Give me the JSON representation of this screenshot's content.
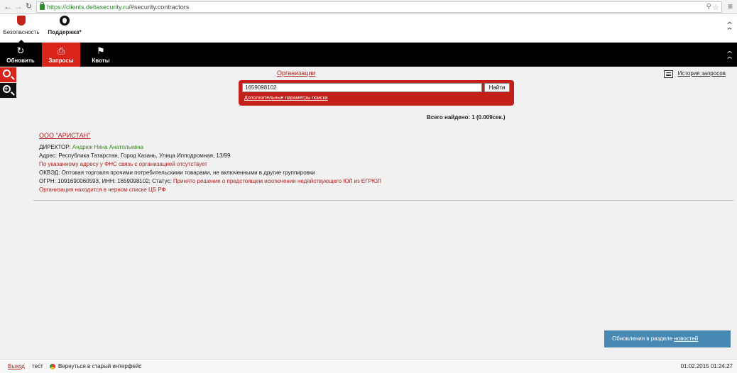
{
  "browser": {
    "url_host": "https://clients.deltasecurity.ru",
    "url_path": "/#security.contractors"
  },
  "topbar": {
    "security_label": "Безопасность",
    "support_label": "Поддержка*"
  },
  "toolbar": {
    "refresh_label": "Обновить",
    "requests_label": "Запросы",
    "quotas_label": "Квоты"
  },
  "search": {
    "category_link": "Организации",
    "query_value": "1659098102",
    "find_button": "Найти",
    "advanced_link": "Дополнительные параметры поиска",
    "history_link": "История запросов",
    "found_text": "Всего найдено: 1 (0.009сек.)"
  },
  "result": {
    "org_name": "ООО \"АРИСТАН\"",
    "director_label": "ДИРЕКТОР: ",
    "director_name": "Андрюк Нина Анатольевна",
    "address": "Адрес: Республика Татарстан, Город Казань, Улица Ипподромная, 13/99",
    "fns_warning": "По указанному адресу у ФНС связь с организацией отсутствует",
    "okved": "ОКВЭД: Оптовая торговля прочими потребительскими товарами, не включенными в другие группировки",
    "ogrn_inn": "ОГРН: 1091690060593, ИНН: 1659098102; Статус: ",
    "status": "Принято решение о предстоящем исключении недействующего ЮЛ из ЕГРЮЛ",
    "blacklist": "Организация находится в черном списке ЦБ РФ"
  },
  "notification": {
    "text": "Обновления в разделе ",
    "link": "новостей"
  },
  "footer": {
    "exit_link": "Выход",
    "user": "тест",
    "old_interface": "Вернуться в старый интерфейс",
    "datetime": "01.02.2015 01:24:27"
  },
  "colors": {
    "accent_red": "#d8241b",
    "link_red": "#b22222",
    "green": "#3a8a1e",
    "notify_blue": "#4a88b4"
  }
}
